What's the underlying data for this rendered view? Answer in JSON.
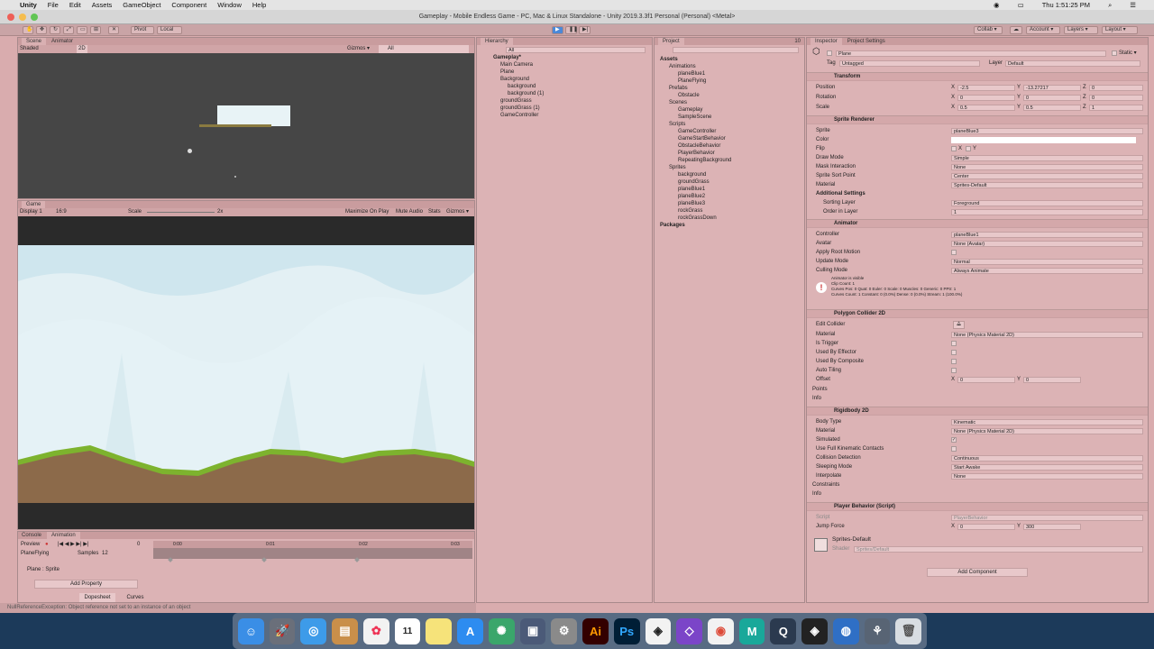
{
  "menubar": {
    "app": "Unity",
    "items": [
      "File",
      "Edit",
      "Assets",
      "GameObject",
      "Component",
      "Window",
      "Help"
    ],
    "clock": "Thu 1:51:25 PM"
  },
  "window_title": "Gameplay - Mobile Endless Game - PC, Mac & Linux Standalone - Unity 2019.3.3f1 Personal (Personal) <Metal>",
  "toolbar": {
    "pivot": "Pivot",
    "local": "Local",
    "collab": "Collab ▾",
    "account": "Account ▾",
    "layers": "Layers ▾",
    "layout": "Layout ▾"
  },
  "scene": {
    "tabs": [
      "Scene",
      "Animator"
    ],
    "shading": "Shaded",
    "mode2d": "2D",
    "gizmos": "Gizmos ▾",
    "search": "All"
  },
  "game": {
    "tab": "Game",
    "display": "Display 1",
    "aspect": "16:9",
    "scale_label": "Scale",
    "scale_value": "2x",
    "maximize": "Maximize On Play",
    "mute": "Mute Audio",
    "stats": "Stats",
    "gizmos": "Gizmos ▾"
  },
  "animation": {
    "tabs": [
      "Console",
      "Animation"
    ],
    "preview": "Preview",
    "frame": "0",
    "clip": "PlaneFlying",
    "samples_label": "Samples",
    "samples": "12",
    "property": "Plane : Sprite",
    "add_property": "Add Property",
    "dopesheet": "Dopesheet",
    "curves": "Curves",
    "ticks": [
      "0:00",
      "0:01",
      "0:02",
      "0:03"
    ]
  },
  "status": "NullReferenceException: Object reference not set to an instance of an object",
  "hierarchy": {
    "title": "Hierarchy",
    "search": "All",
    "items": [
      {
        "label": "Gameplay*",
        "depth": 0
      },
      {
        "label": "Main Camera",
        "depth": 1
      },
      {
        "label": "Plane",
        "depth": 1
      },
      {
        "label": "Background",
        "depth": 1
      },
      {
        "label": "background",
        "depth": 2
      },
      {
        "label": "background (1)",
        "depth": 2
      },
      {
        "label": "groundGrass",
        "depth": 1
      },
      {
        "label": "groundGrass (1)",
        "depth": 1
      },
      {
        "label": "GameController",
        "depth": 1
      }
    ]
  },
  "project": {
    "title": "Project",
    "count": "10",
    "items": [
      {
        "label": "Assets",
        "depth": 0,
        "bold": true
      },
      {
        "label": "Animations",
        "depth": 1
      },
      {
        "label": "planeBlue1",
        "depth": 2
      },
      {
        "label": "PlaneFlying",
        "depth": 2
      },
      {
        "label": "Prefabs",
        "depth": 1
      },
      {
        "label": "Obstacle",
        "depth": 2
      },
      {
        "label": "Scenes",
        "depth": 1
      },
      {
        "label": "Gameplay",
        "depth": 2
      },
      {
        "label": "SampleScene",
        "depth": 2
      },
      {
        "label": "Scripts",
        "depth": 1
      },
      {
        "label": "GameController",
        "depth": 2
      },
      {
        "label": "GameStartBehavior",
        "depth": 2
      },
      {
        "label": "ObstacleBehavior",
        "depth": 2
      },
      {
        "label": "PlayerBehavior",
        "depth": 2
      },
      {
        "label": "RepeatingBackground",
        "depth": 2
      },
      {
        "label": "Sprites",
        "depth": 1
      },
      {
        "label": "background",
        "depth": 2
      },
      {
        "label": "groundGrass",
        "depth": 2
      },
      {
        "label": "planeBlue1",
        "depth": 2
      },
      {
        "label": "planeBlue2",
        "depth": 2
      },
      {
        "label": "planeBlue3",
        "depth": 2
      },
      {
        "label": "rockGrass",
        "depth": 2
      },
      {
        "label": "rockGrassDown",
        "depth": 2
      },
      {
        "label": "Packages",
        "depth": 0,
        "bold": true
      }
    ]
  },
  "inspector": {
    "tabs": [
      "Inspector",
      "Project Settings"
    ],
    "object_name": "Plane",
    "static": "Static ▾",
    "tag_label": "Tag",
    "tag": "Untagged",
    "layer_label": "Layer",
    "layer": "Default",
    "transform": {
      "title": "Transform",
      "position_label": "Position",
      "pos_x": "-2.5",
      "pos_y": "-13.27217",
      "pos_z": "0",
      "rotation_label": "Rotation",
      "rot_x": "0",
      "rot_y": "0",
      "rot_z": "0",
      "scale_label": "Scale",
      "scl_x": "0.5",
      "scl_y": "0.5",
      "scl_z": "1"
    },
    "sprite_renderer": {
      "title": "Sprite Renderer",
      "sprite_label": "Sprite",
      "sprite": "planeBlue3",
      "color_label": "Color",
      "flip_label": "Flip",
      "flip_x": "X",
      "flip_y": "Y",
      "draw_mode_label": "Draw Mode",
      "draw_mode": "Simple",
      "mask_label": "Mask Interaction",
      "mask": "None",
      "sort_point_label": "Sprite Sort Point",
      "sort_point": "Center",
      "material_label": "Material",
      "material": "Sprites-Default",
      "additional": "Additional Settings",
      "sorting_layer_label": "Sorting Layer",
      "sorting_layer": "Foreground",
      "order_label": "Order in Layer",
      "order": "1"
    },
    "animator": {
      "title": "Animator",
      "controller_label": "Controller",
      "controller": "planeBlue1",
      "avatar_label": "Avatar",
      "avatar": "None (Avatar)",
      "root_motion_label": "Apply Root Motion",
      "update_label": "Update Mode",
      "update": "Normal",
      "culling_label": "Culling Mode",
      "culling": "Always Animate",
      "info": [
        "Animator is visible",
        "Clip Count: 1",
        "Curves Pos: 0 Quat: 0 Euler: 0 Scale: 0 Muscles: 0 Generic: 0 PPtr: 1",
        "Curves Count: 1 Constant: 0 (0.0%) Dense: 0 (0.0%) Stream: 1 (100.0%)"
      ]
    },
    "polygon_collider": {
      "title": "Polygon Collider 2D",
      "edit_label": "Edit Collider",
      "material_label": "Material",
      "material": "None (Physics Material 2D)",
      "trigger_label": "Is Trigger",
      "effector_label": "Used By Effector",
      "composite_label": "Used By Composite",
      "tiling_label": "Auto Tiling",
      "offset_label": "Offset",
      "off_x": "0",
      "off_y": "0",
      "points_label": "Points",
      "info_label": "Info"
    },
    "rigidbody": {
      "title": "Rigidbody 2D",
      "body_type_label": "Body Type",
      "body_type": "Kinematic",
      "material_label": "Material",
      "material": "None (Physics Material 2D)",
      "simulated_label": "Simulated",
      "full_kin_label": "Use Full Kinematic Contacts",
      "collision_label": "Collision Detection",
      "collision": "Continuous",
      "sleeping_label": "Sleeping Mode",
      "sleeping": "Start Awake",
      "interpolate_label": "Interpolate",
      "interpolate": "None",
      "constraints_label": "Constraints",
      "info_label": "Info"
    },
    "player_behavior": {
      "title": "Player Behavior (Script)",
      "script_label": "Script",
      "script": "PlayerBehavior",
      "jump_label": "Jump Force",
      "jump_x": "0",
      "jump_y": "300"
    },
    "material_preview": {
      "name": "Sprites-Default",
      "shader_label": "Shader",
      "shader": "Sprites/Default"
    },
    "add_component": "Add Component"
  },
  "dock_apps": [
    "Finder",
    "Launchpad",
    "Safari",
    "Notes",
    "Photos",
    "Calendar",
    "Stickies",
    "App Store",
    "Network",
    "Screenshot",
    "System Preferences",
    "Illustrator",
    "Photoshop",
    "Unity Hub",
    "Visual Studio",
    "Chrome",
    "Maya",
    "QuickTime",
    "Unity",
    "Globe",
    "Migration",
    "Trash"
  ],
  "dock_calendar_day": "11",
  "colors": {
    "tint": "#dcb3b5",
    "game_sky": "#dcedf3",
    "ground": "#8c6a4a",
    "grass": "#7db32e"
  }
}
